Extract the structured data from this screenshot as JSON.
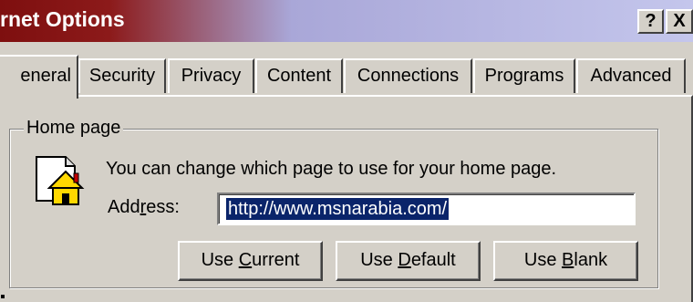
{
  "window": {
    "title": "rnet Options",
    "help_glyph": "?",
    "close_glyph": "X"
  },
  "tabs": [
    {
      "label": "eneral",
      "active": true
    },
    {
      "label": "Security"
    },
    {
      "label": "Privacy"
    },
    {
      "label": "Content"
    },
    {
      "label": "Connections"
    },
    {
      "label": "Programs"
    },
    {
      "label": "Advanced"
    }
  ],
  "home_page": {
    "group_label": "Home page",
    "icon": "home-page-icon",
    "description": "You can change which page to use for your home page.",
    "address_label_pre": "Add",
    "address_label_accel": "r",
    "address_label_post": "ess:",
    "address_value": "http://www.msnarabia.com/",
    "buttons": {
      "use_current": {
        "pre": "Use ",
        "accel": "C",
        "post": "urrent"
      },
      "use_default": {
        "pre": "Use ",
        "accel": "D",
        "post": "efault"
      },
      "use_blank": {
        "pre": "Use ",
        "accel": "B",
        "post": "lank"
      }
    }
  },
  "colors": {
    "title_start": "#7e0f0f",
    "title_end": "#c4c6ec",
    "face": "#d4d0c8",
    "selection": "#0a246a"
  }
}
